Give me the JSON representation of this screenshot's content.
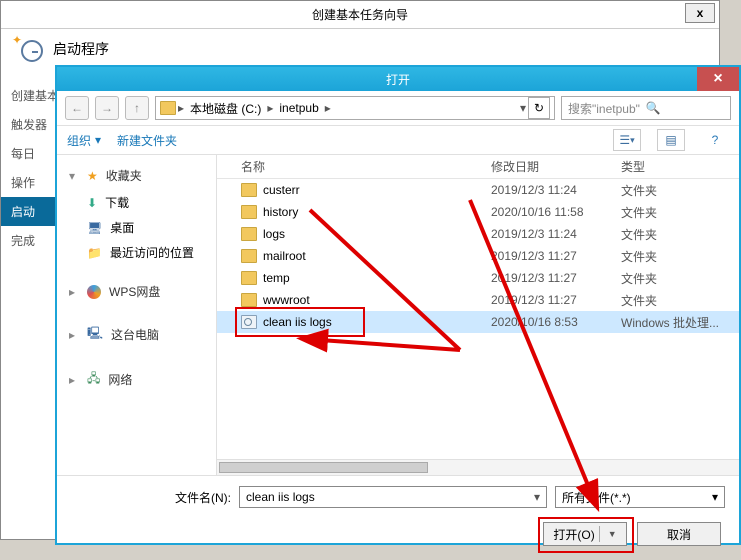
{
  "wizard": {
    "title": "创建基本任务向导",
    "close": "x",
    "subtitle": "启动程序",
    "sidebar": [
      "创建基本",
      "触发器",
      "每日",
      "操作",
      "启动",
      "完成"
    ],
    "selected_index": 4
  },
  "opendlg": {
    "title": "打开",
    "close": "×",
    "nav_back": "←",
    "nav_fwd": "→",
    "nav_up": "↑",
    "breadcrumb": [
      "本地磁盘 (C:)",
      "inetpub"
    ],
    "bc_arrow": "▸",
    "bc_dd": "▾",
    "refresh": "↻",
    "search_placeholder": "搜索\"inetpub\"",
    "toolbar": {
      "organize": "组织",
      "newfolder": "新建文件夹",
      "dd": "▾",
      "help": "?"
    },
    "cols": {
      "name": "名称",
      "date": "修改日期",
      "type": "类型"
    },
    "tree": {
      "fav": "收藏夹",
      "downloads": "下载",
      "desktop": "桌面",
      "recent": "最近访问的位置",
      "wps": "WPS网盘",
      "thispc": "这台电脑",
      "network": "网络",
      "arrow_r": "▸",
      "arrow_d": "▾"
    },
    "rows": [
      {
        "name": "custerr",
        "date": "2019/12/3 11:24",
        "type": "文件夹",
        "kind": "folder"
      },
      {
        "name": "history",
        "date": "2020/10/16 11:58",
        "type": "文件夹",
        "kind": "folder"
      },
      {
        "name": "logs",
        "date": "2019/12/3 11:24",
        "type": "文件夹",
        "kind": "folder"
      },
      {
        "name": "mailroot",
        "date": "2019/12/3 11:27",
        "type": "文件夹",
        "kind": "folder"
      },
      {
        "name": "temp",
        "date": "2019/12/3 11:27",
        "type": "文件夹",
        "kind": "folder"
      },
      {
        "name": "wwwroot",
        "date": "2019/12/3 11:27",
        "type": "文件夹",
        "kind": "folder"
      },
      {
        "name": "clean iis logs",
        "date": "2020/10/16 8:53",
        "type": "Windows 批处理...",
        "kind": "bat",
        "selected": true
      }
    ],
    "filename_label": "文件名(N):",
    "filename_value": "clean iis logs",
    "filter_value": "所有文件(*.*)",
    "filter_dd": "▾",
    "open_btn": "打开(O)",
    "open_dd": "▼",
    "cancel_btn": "取消"
  }
}
